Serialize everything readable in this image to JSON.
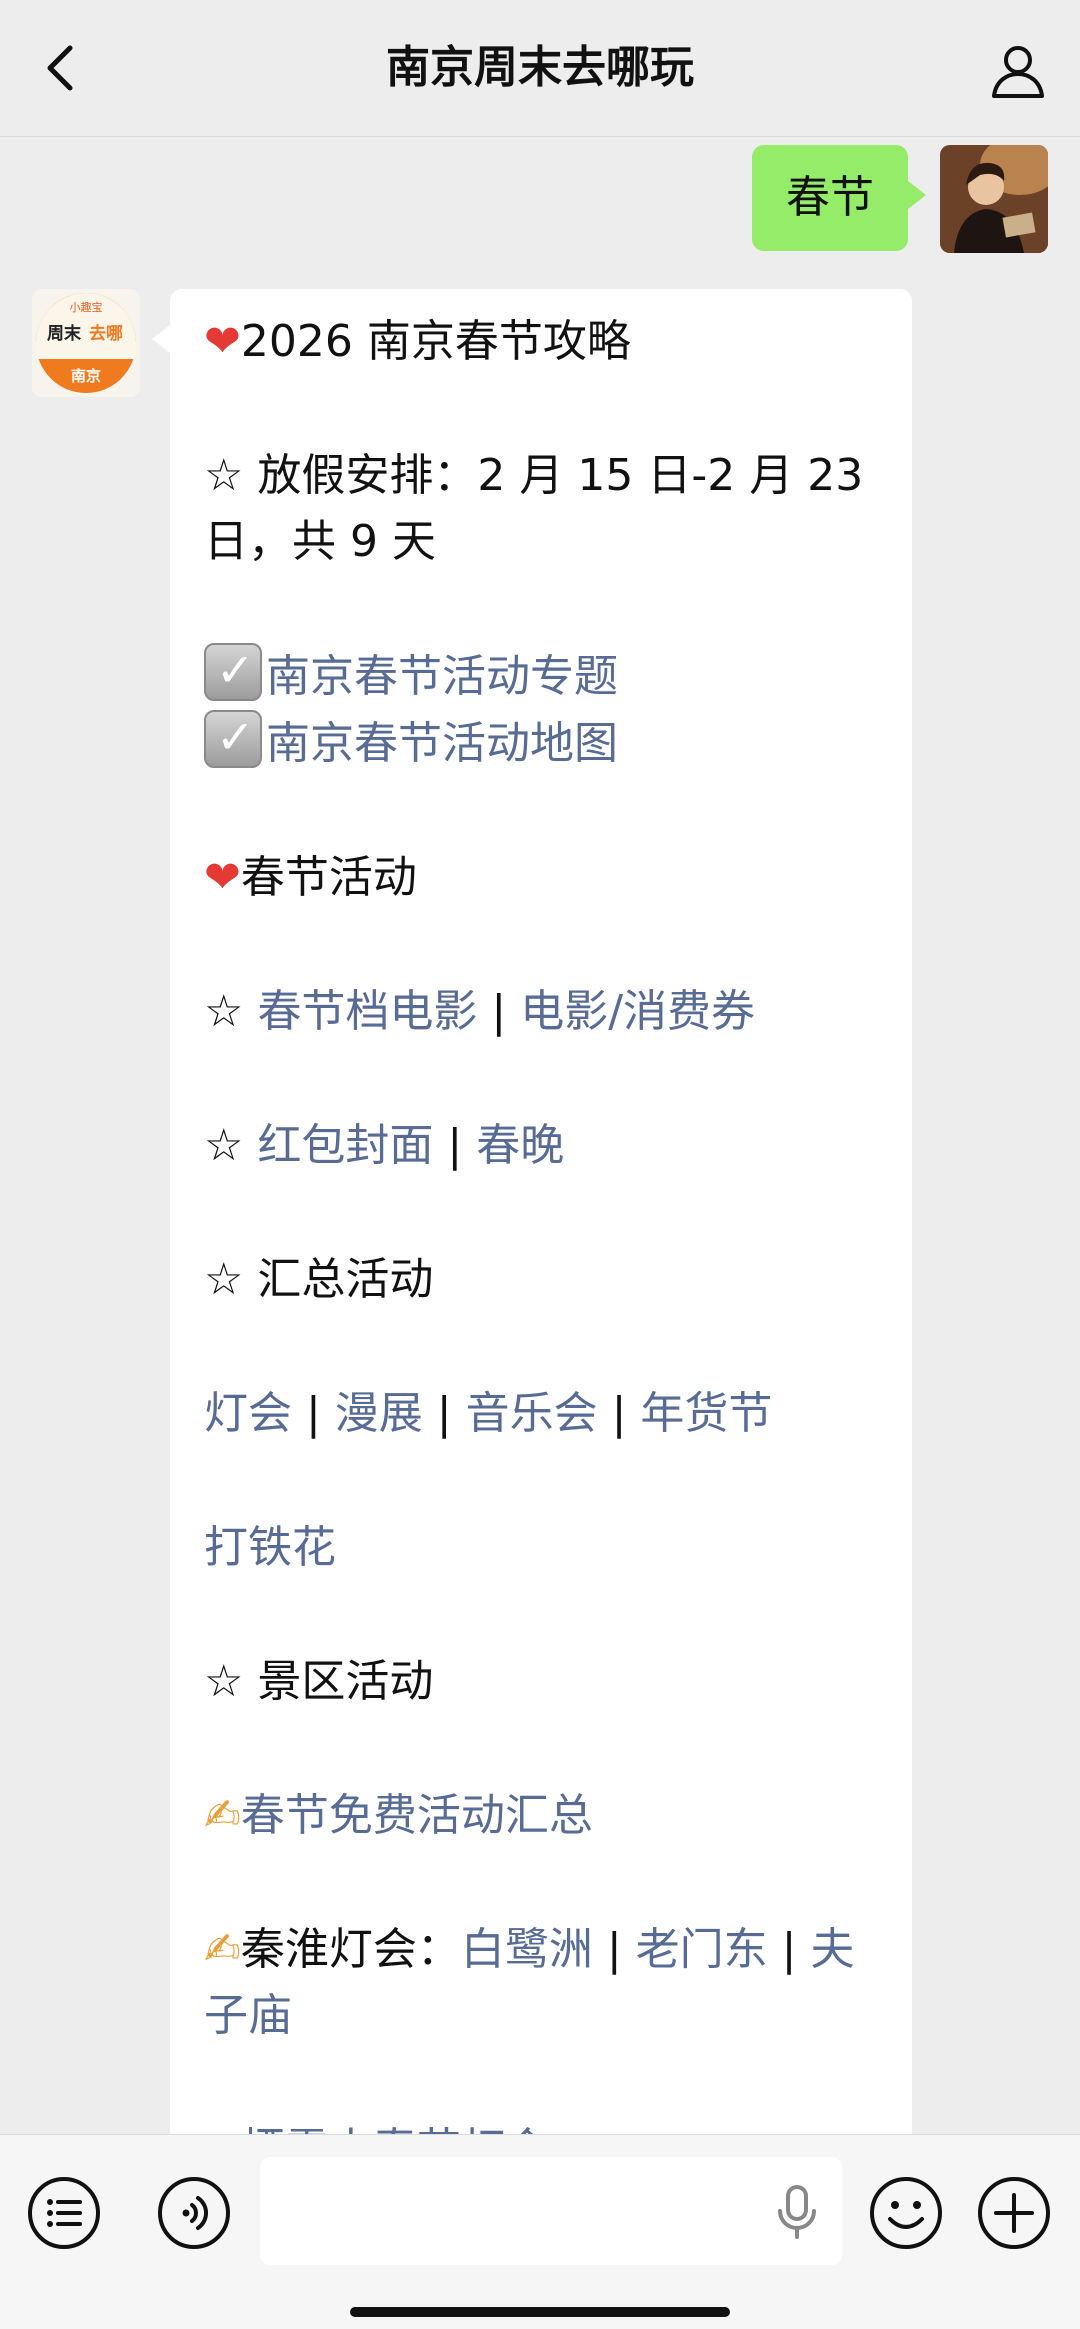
{
  "header": {
    "title": "南京周末去哪玩"
  },
  "user_message": "春节",
  "bot_logo": {
    "top_text": "小趣宝",
    "main_text_a": "周末",
    "main_text_b": "去哪",
    "bottom_text": "南京"
  },
  "bot_message": {
    "title": "2026 南京春节攻略",
    "holiday": "☆ 放假安排：2 月 15 日-2 月 23 日，共 9 天",
    "link_topic": "南京春节活动专题",
    "link_map": "南京春节活动地图",
    "section_spring": "春节活动",
    "star": "☆ ",
    "movie": "春节档电影",
    "coupon": "电影/消费券",
    "hongbao": "红包封面",
    "gala": "春晚",
    "summary_heading": "☆ 汇总活动",
    "lantern": "灯会",
    "comic": "漫展",
    "concert": "音乐会",
    "newyear_market": "年货节",
    "iron_flower": "打铁花",
    "scenic_heading": "☆ 景区活动",
    "free_activities": "春节免费活动汇总",
    "qinhuai": "秦淮灯会：",
    "bailuzhou": "白鹭洲",
    "laomendong": "老门东",
    "fuzimiao": "夫子庙",
    "cutoff_line": "栖霞山春节灯会",
    "sep": " | "
  }
}
